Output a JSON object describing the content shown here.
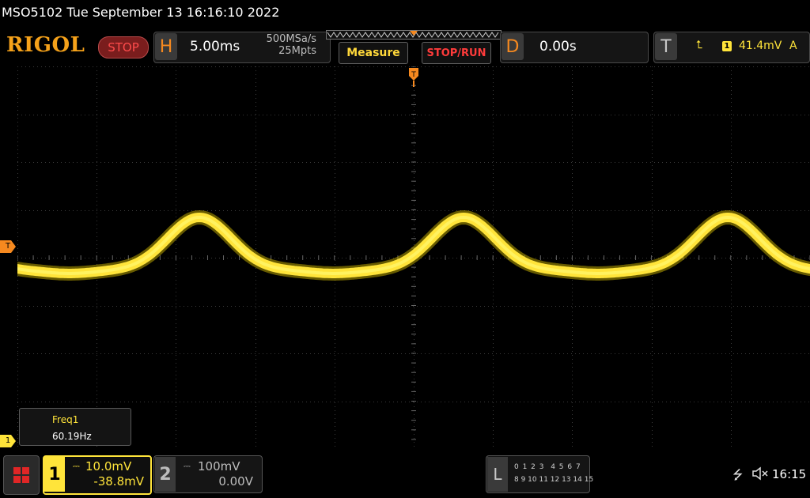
{
  "title": "MSO5102  Tue September 13 16:16:10 2022",
  "brand": {
    "logo": "RIGOL",
    "run_state": "STOP"
  },
  "horizontal": {
    "letter": "H",
    "timebase": "5.00ms",
    "sample_rate": "500MSa/s",
    "memory_depth": "25Mpts"
  },
  "buttons": {
    "measure": "Measure",
    "stop_run": "STOP/RUN"
  },
  "delay": {
    "letter": "D",
    "value": "0.00s"
  },
  "trigger": {
    "letter": "T",
    "slope_icon": "rising-edge-icon",
    "slope_glyph": "⮤",
    "source": "1",
    "level": "41.4mV",
    "mode": "A"
  },
  "markers": {
    "trigger_level": "T",
    "ch1_ground": "1",
    "trigger_position": "T"
  },
  "measurement": {
    "name": "Freq1",
    "value": "60.19Hz"
  },
  "channel1": {
    "number": "1",
    "coupling_glyph": "⎓",
    "scale": "10.0mV",
    "offset": "-38.8mV",
    "color": "#ffe43a"
  },
  "channel2": {
    "number": "2",
    "coupling_glyph": "⎓",
    "scale": "100mV",
    "offset": "0.00V",
    "color": "#bdbdbd"
  },
  "logic": {
    "letter": "L",
    "row1": "0 1 2 3  4 5 6 7",
    "row2": "8 9 10 11 12 13 14 15"
  },
  "status": {
    "usb_glyph": "⭍",
    "clock": "16:15"
  },
  "colors": {
    "accent_orange": "#f6891f",
    "logo_orange": "#f6a21a",
    "trace_yellow": "#ffe43a",
    "stop_red": "#ff3b3b"
  }
}
